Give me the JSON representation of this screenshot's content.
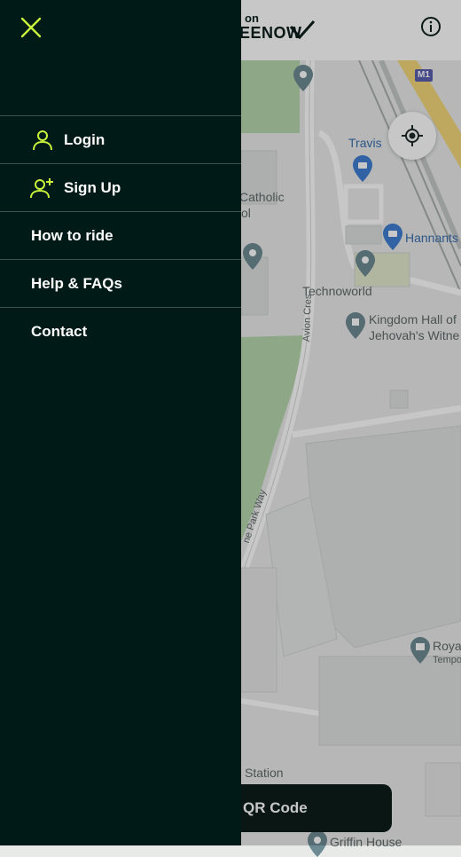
{
  "app": {
    "brand_top": "on",
    "brand_main": "EENOW"
  },
  "colors": {
    "drawer_bg": "#001b17",
    "accent": "#c8f23c",
    "divider": "#3d514d",
    "map_bg": "#e8eae8",
    "park_green": "#b7d8b0",
    "qr_bar_bg": "#0d1d1a"
  },
  "drawer": {
    "close_icon": "close-icon",
    "items": [
      {
        "label": "Login",
        "icon": "user-icon"
      },
      {
        "label": "Sign Up",
        "icon": "user-plus-icon"
      },
      {
        "label": "How to ride"
      },
      {
        "label": "Help & FAQs"
      },
      {
        "label": "Contact"
      }
    ]
  },
  "map": {
    "labels": {
      "travis": "Travis",
      "catholic": "Catholic",
      "catholic_line2": "ol",
      "hannants": "Hannants",
      "technoworld": "Technoworld",
      "kingdom_hall": "Kingdom Hall of",
      "kingdom_hall_line2": "Jehovah's Witne",
      "avion_cres": "Avion Cres",
      "park_way": "ne Park Way",
      "roya": "Roya",
      "tempo": "Tempo",
      "station": "Station",
      "griffin_house": "Griffin House",
      "m1": "M1"
    },
    "info_icon": "info-icon",
    "locate_icon": "locate-icon"
  },
  "qr_bar": {
    "label": "QR Code"
  }
}
